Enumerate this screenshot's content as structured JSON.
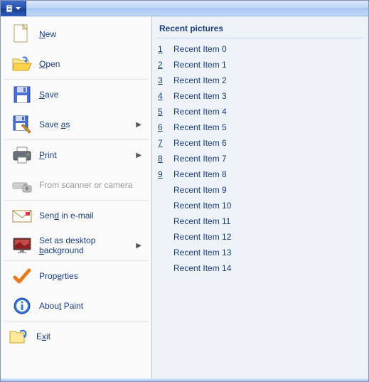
{
  "titlebar": {
    "icon": "doc-icon"
  },
  "menu": {
    "new": {
      "pre": "",
      "u": "N",
      "post": "ew"
    },
    "open": {
      "pre": "",
      "u": "O",
      "post": "pen"
    },
    "save": {
      "pre": "",
      "u": "S",
      "post": "ave"
    },
    "save_as": {
      "pre": "Save ",
      "u": "a",
      "post": "s"
    },
    "print": {
      "pre": "",
      "u": "P",
      "post": "rint"
    },
    "scanner": {
      "label": "From scanner or camera"
    },
    "send_email": {
      "pre": "Sen",
      "u": "d",
      "post": " in e-mail"
    },
    "background": {
      "pre": "Set as desktop ",
      "u": "b",
      "post": "ackground"
    },
    "properties": {
      "pre": "Prop",
      "u": "e",
      "post": "rties"
    },
    "about": {
      "pre": "Abou",
      "u": "t",
      "post": " Paint"
    },
    "exit": {
      "pre": "E",
      "u": "x",
      "post": "it"
    }
  },
  "recent": {
    "heading": "Recent pictures",
    "items": [
      {
        "num": "1",
        "label": "Recent Item 0"
      },
      {
        "num": "2",
        "label": "Recent Item 1"
      },
      {
        "num": "3",
        "label": "Recent Item 2"
      },
      {
        "num": "4",
        "label": "Recent Item 3"
      },
      {
        "num": "5",
        "label": "Recent Item 4"
      },
      {
        "num": "6",
        "label": "Recent Item 5"
      },
      {
        "num": "7",
        "label": "Recent Item 6"
      },
      {
        "num": "8",
        "label": "Recent Item 7"
      },
      {
        "num": "9",
        "label": "Recent Item 8"
      },
      {
        "num": "",
        "label": "Recent Item 9"
      },
      {
        "num": "",
        "label": "Recent Item 10"
      },
      {
        "num": "",
        "label": "Recent Item 11"
      },
      {
        "num": "",
        "label": "Recent Item 12"
      },
      {
        "num": "",
        "label": "Recent Item 13"
      },
      {
        "num": "",
        "label": "Recent Item 14"
      }
    ]
  }
}
